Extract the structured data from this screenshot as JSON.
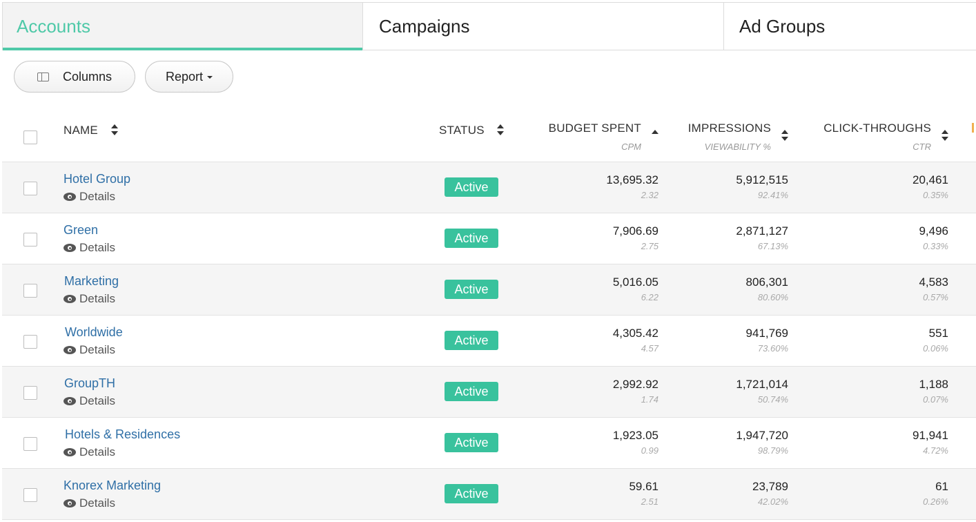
{
  "tabs": [
    {
      "label": "Accounts",
      "active": true
    },
    {
      "label": "Campaigns",
      "active": false
    },
    {
      "label": "Ad Groups",
      "active": false
    }
  ],
  "toolbar": {
    "columns_label": "Columns",
    "report_label": "Report"
  },
  "table": {
    "headers": {
      "name": "NAME",
      "status": "STATUS",
      "budget": "BUDGET SPENT",
      "budget_sub": "CPM",
      "impressions": "IMPRESSIONS",
      "impressions_sub": "VIEWABILITY %",
      "clicks": "CLICK-THROUGHS",
      "clicks_sub": "CTR"
    },
    "details_label": "Details",
    "rows": [
      {
        "name": "Hotel Group",
        "status": "Active",
        "budget": "13,695.32",
        "cpm": "2.32",
        "impressions": "5,912,515",
        "viewability": "92.41%",
        "clicks": "20,461",
        "ctr": "0.35%"
      },
      {
        "name": "Green",
        "status": "Active",
        "budget": "7,906.69",
        "cpm": "2.75",
        "impressions": "2,871,127",
        "viewability": "67.13%",
        "clicks": "9,496",
        "ctr": "0.33%"
      },
      {
        "name": "Marketing",
        "status": "Active",
        "budget": "5,016.05",
        "cpm": "6.22",
        "impressions": "806,301",
        "viewability": "80.60%",
        "clicks": "4,583",
        "ctr": "0.57%"
      },
      {
        "name": "Worldwide",
        "status": "Active",
        "budget": "4,305.42",
        "cpm": "4.57",
        "impressions": "941,769",
        "viewability": "73.60%",
        "clicks": "551",
        "ctr": "0.06%"
      },
      {
        "name": "GroupTH",
        "status": "Active",
        "budget": "2,992.92",
        "cpm": "1.74",
        "impressions": "1,721,014",
        "viewability": "50.74%",
        "clicks": "1,188",
        "ctr": "0.07%"
      },
      {
        "name": "Hotels & Residences",
        "status": "Active",
        "budget": "1,923.05",
        "cpm": "0.99",
        "impressions": "1,947,720",
        "viewability": "98.79%",
        "clicks": "91,941",
        "ctr": "4.72%"
      },
      {
        "name": "Knorex Marketing",
        "status": "Active",
        "budget": "59.61",
        "cpm": "2.51",
        "impressions": "23,789",
        "viewability": "42.02%",
        "clicks": "61",
        "ctr": "0.26%"
      }
    ]
  },
  "colors": {
    "accent": "#4fc9a8",
    "status_active": "#39c29d",
    "link": "#2f6fa6"
  }
}
